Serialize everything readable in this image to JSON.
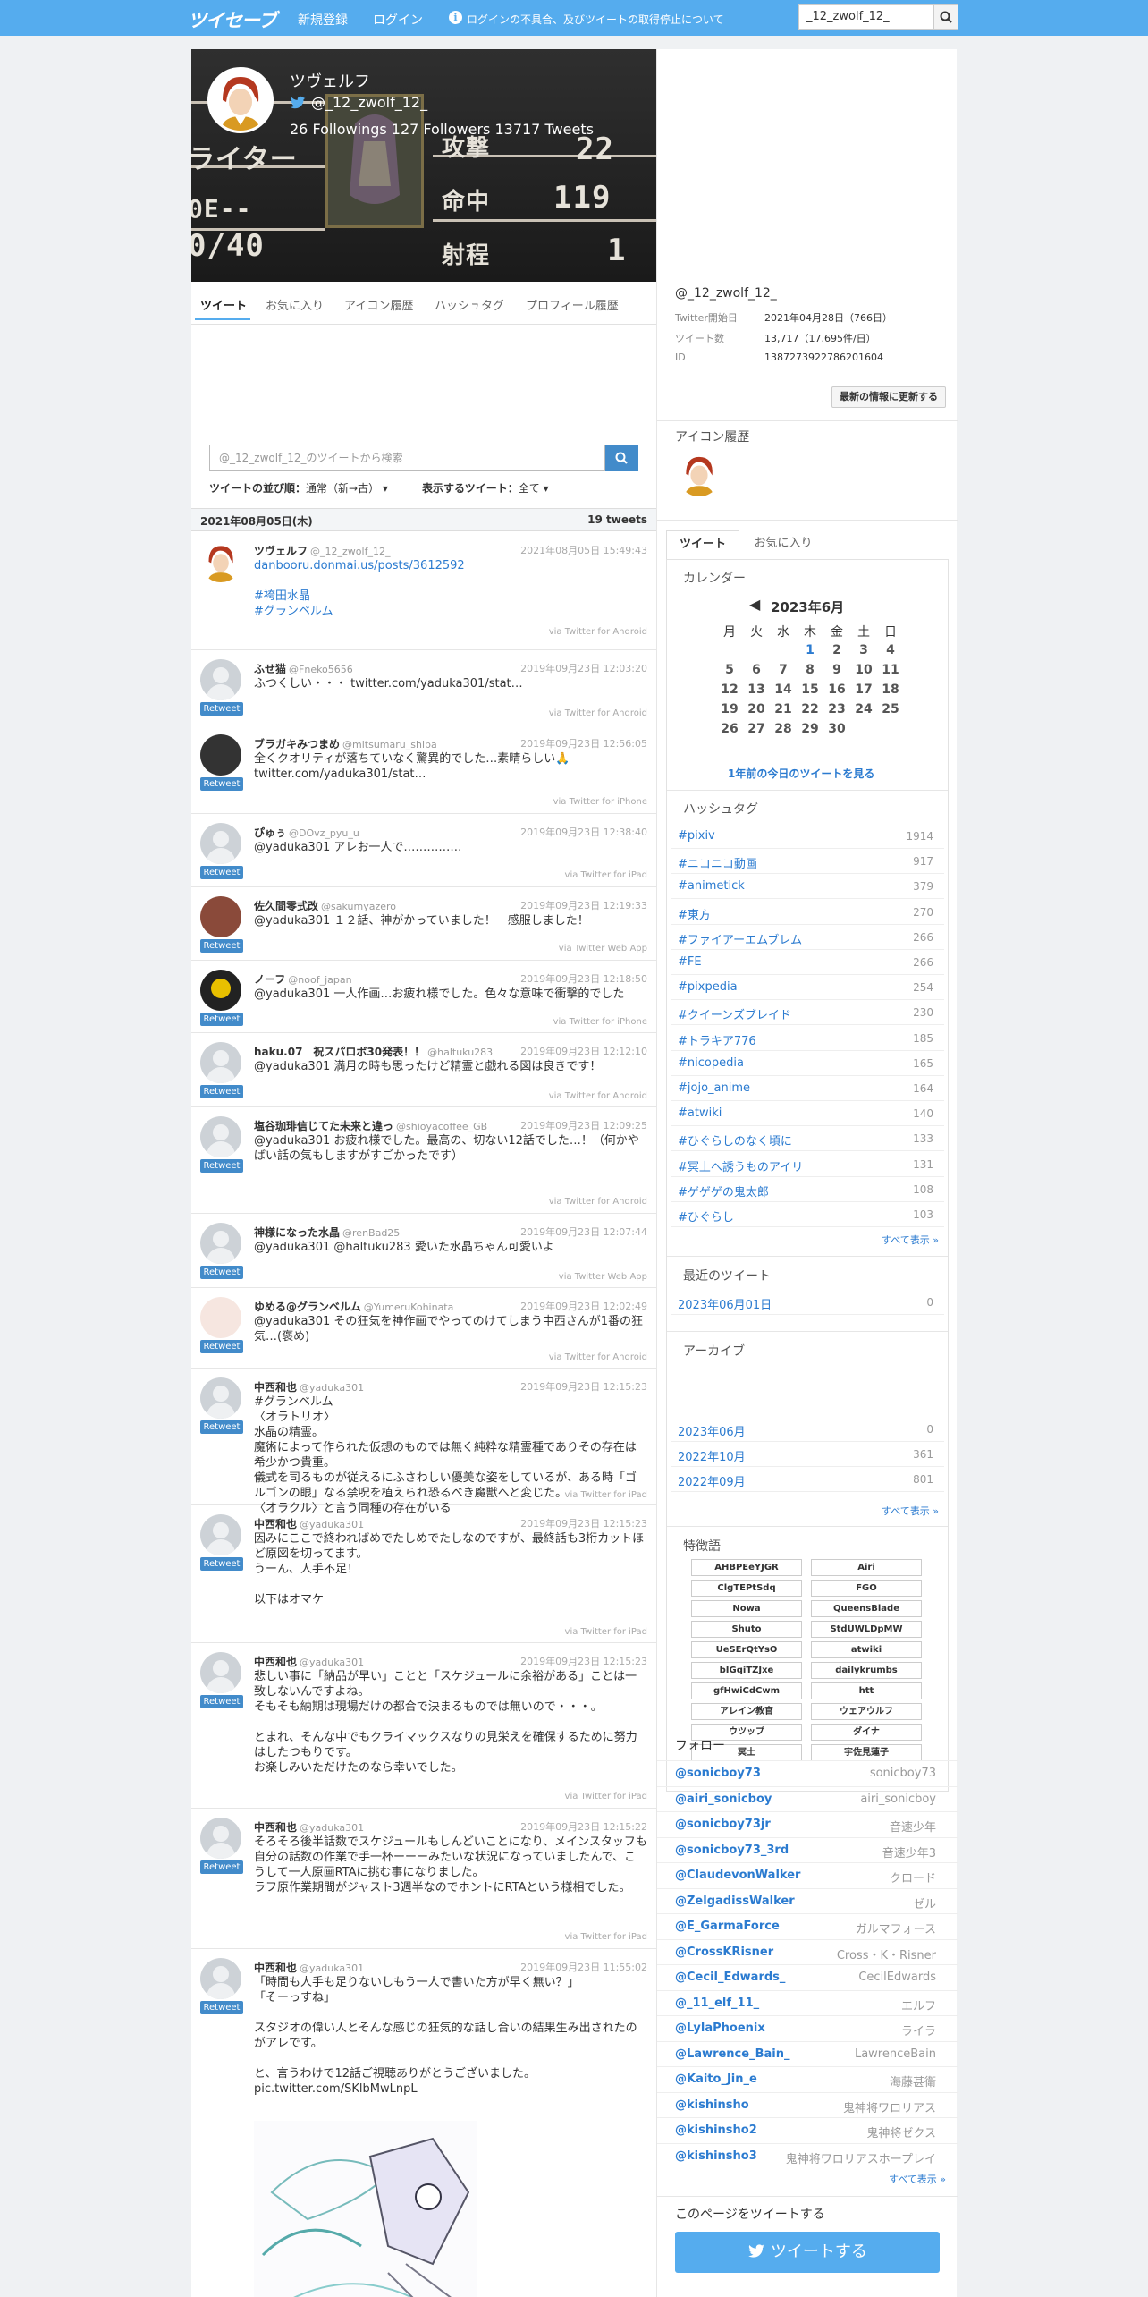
{
  "nav": {
    "logo": "ツイセーブ",
    "register": "新規登録",
    "login": "ログイン",
    "notice": "ログインの不具合、及びツイートの取得停止について",
    "search_value": "_12_zwolf_12_"
  },
  "profile": {
    "name": "ツヴェルフ",
    "handle": "@_12_zwolf_12_",
    "stats": "26 Followings 127 Followers  13717 Tweets",
    "banner_text": [
      "ライター",
      "0E--",
      "0/40",
      "攻撃",
      "22",
      "命中",
      "119",
      "射程",
      "1"
    ]
  },
  "tabs": [
    "ツイート",
    "お気に入り",
    "アイコン履歴",
    "ハッシュタグ",
    "プロフィール履歴"
  ],
  "search": {
    "placeholder": "@_12_zwolf_12_のツイートから検索"
  },
  "sort": {
    "order_label": "ツイートの並び順：",
    "order_value": "通常（新→古）",
    "show_label": "表示するツイート：",
    "show_value": "全て"
  },
  "date_header": {
    "date": "2021年08月05日(木)",
    "count": "19 tweets"
  },
  "tweets": [
    {
      "name": "ツヴェルフ",
      "handle": "@_12_zwolf_12_",
      "time": "2021年08月05日 15:49:43",
      "body": "danbooru.donmai.us/posts/3612592\n\n#袴田水晶\n#グランベルム",
      "via": "via Twitter for Android",
      "retweet": ""
    },
    {
      "name": "ふせ猫",
      "handle": "@Fneko5656",
      "time": "2019年09月23日 12:03:20",
      "body": "ふつくしい・・・ twitter.com/yaduka301/stat…",
      "via": "via Twitter for Android",
      "retweet": "Retweet"
    },
    {
      "name": "ブラガキみつまめ",
      "handle": "@mitsumaru_shiba",
      "time": "2019年09月23日 12:56:05",
      "body": "全くクオリティが落ちていなく驚異的でした…素晴らしい🙏 twitter.com/yaduka301/stat…",
      "via": "via Twitter for iPhone",
      "retweet": "Retweet"
    },
    {
      "name": "ぴゅぅ",
      "handle": "@DOvz_pyu_u",
      "time": "2019年09月23日 12:38:40",
      "body": "@yaduka301 アレお一人で……………",
      "via": "via Twitter for iPad",
      "retweet": "Retweet"
    },
    {
      "name": "佐久間零式改",
      "handle": "@sakumyazero",
      "time": "2019年09月23日 12:19:33",
      "body": "@yaduka301 １２話、神がかっていました！　感服しました！",
      "via": "via Twitter Web App",
      "retweet": "Retweet"
    },
    {
      "name": "ノーフ",
      "handle": "@noof_japan",
      "time": "2019年09月23日 12:18:50",
      "body": "@yaduka301 一人作画…お疲れ様でした。色々な意味で衝撃的でした",
      "via": "via Twitter for iPhone",
      "retweet": "Retweet"
    },
    {
      "name": "haku.07　祝スパロボ30発表！！",
      "handle": "@haltuku283",
      "time": "2019年09月23日 12:12:10",
      "body": "@yaduka301 満月の時も思ったけど精霊と戯れる図は良きです！",
      "via": "via Twitter for Android",
      "retweet": "Retweet"
    },
    {
      "name": "塩谷珈琲信じてた未来と違っ",
      "handle": "@shioyacoffee_GB",
      "time": "2019年09月23日 12:09:25",
      "body": "@yaduka301 お疲れ様でした。最高の、切ない12話でした…！（何かやばい話の気もしますがすごかったです）",
      "via": "via Twitter for Android",
      "retweet": "Retweet"
    },
    {
      "name": "神様になった水晶",
      "handle": "@renBad25",
      "time": "2019年09月23日 12:07:44",
      "body": "@yaduka301 @haltuku283 愛いた水晶ちゃん可愛いよ",
      "via": "via Twitter Web App",
      "retweet": "Retweet"
    },
    {
      "name": "ゆめる@グランベルム",
      "handle": "@YumeruKohinata",
      "time": "2019年09月23日 12:02:49",
      "body": "@yaduka301 その狂気を神作画でやってのけてしまう中西さんが1番の狂気…(褒め)",
      "via": "via Twitter for Android",
      "retweet": "Retweet"
    },
    {
      "name": "中西和也",
      "handle": "@yaduka301",
      "time": "2019年09月23日 12:15:23",
      "body": "#グランベルム\n〈オラトリオ〉\n水晶の精霊。\n魔術によって作られた仮想のものでは無く純粋な精霊種でありその存在は希少かつ貴重。\n儀式を司るものが従えるにふさわしい優美な姿をしているが、ある時「ゴルゴンの眼」なる禁呪を植えられ恐るべき魔獣へと変じた。\n〈オラクル〉と言う同種の存在がいる",
      "via": "via Twitter for iPad",
      "retweet": "Retweet"
    },
    {
      "name": "中西和也",
      "handle": "@yaduka301",
      "time": "2019年09月23日 12:15:23",
      "body": "因みにここで終わればめでたしめでたしなのですが、最終話も3桁カットほど原図を切ってます。\nうーん、人手不足！\n\n以下はオマケ",
      "via": "via Twitter for iPad",
      "retweet": "Retweet"
    },
    {
      "name": "中西和也",
      "handle": "@yaduka301",
      "time": "2019年09月23日 12:15:23",
      "body": "悲しい事に「納品が早い」ことと「スケジュールに余裕がある」ことは一致しないんですよね。\nそもそも納期は現場だけの都合で決まるものでは無いので・・・。\n\nとまれ、そんな中でもクライマックスなりの見栄えを確保するために努力はしたつもりです。\nお楽しみいただけたのなら幸いでした。",
      "via": "via Twitter for iPad",
      "retweet": "Retweet"
    },
    {
      "name": "中西和也",
      "handle": "@yaduka301",
      "time": "2019年09月23日 12:15:22",
      "body": "そろそろ後半話数でスケジュールもしんどいことになり、メインスタッフも自分の話数の作業で手一杯ーーーみたいな状況になっていましたんで、こうして一人原画RTAに挑む事になりました。\nラフ原作業期間がジャスト3週半なのでホントにRTAという様相でした。",
      "via": "via Twitter for iPad",
      "retweet": "Retweet"
    },
    {
      "name": "中西和也",
      "handle": "@yaduka301",
      "time": "2019年09月23日 11:55:02",
      "body": "「時間も人手も足りないしもう一人で書いた方が早く無い？」\n「そーっすね」\n\nスタジオの偉い人とそんな感じの狂気的な話し合いの結果生み出されたのがアレです。\n\nと、言うわけで12話ご視聴ありがとうございました。 pic.twitter.com/SKlbMwLnpL",
      "via": "",
      "retweet": "Retweet"
    }
  ],
  "sidebar": {
    "handle": "@_12_zwolf_12_",
    "info": [
      {
        "k": "Twitter開始日",
        "v": "2021年04月28日（766日）"
      },
      {
        "k": "ツイート数",
        "v": "13,717（17.695件/日）"
      },
      {
        "k": "ID",
        "v": "1387273922786201604"
      }
    ],
    "update_button": "最新の情報に更新する",
    "icon_history_title": "アイコン履歴",
    "tabs": [
      "ツイート",
      "お気に入り"
    ],
    "calendar": {
      "title": "カレンダー",
      "month": "2023年6月",
      "weekdays": [
        "月",
        "火",
        "水",
        "木",
        "金",
        "土",
        "日"
      ],
      "weeks": [
        [
          "",
          "",
          "",
          "1",
          "2",
          "3",
          "4"
        ],
        [
          "5",
          "6",
          "7",
          "8",
          "9",
          "10",
          "11"
        ],
        [
          "12",
          "13",
          "14",
          "15",
          "16",
          "17",
          "18"
        ],
        [
          "19",
          "20",
          "21",
          "22",
          "23",
          "24",
          "25"
        ],
        [
          "26",
          "27",
          "28",
          "29",
          "30",
          "",
          ""
        ]
      ],
      "link": "1年前の今日のツイートを見る",
      "highlight": "1"
    },
    "hashtags_title": "ハッシュタグ",
    "hashtags": [
      {
        "k": "#pixiv",
        "v": "1914"
      },
      {
        "k": "#ニコニコ動画",
        "v": "917"
      },
      {
        "k": "#animetick",
        "v": "379"
      },
      {
        "k": "#東方",
        "v": "270"
      },
      {
        "k": "#ファイアーエムブレム",
        "v": "266"
      },
      {
        "k": "#FE",
        "v": "266"
      },
      {
        "k": "#pixpedia",
        "v": "254"
      },
      {
        "k": "#クイーンズブレイド",
        "v": "230"
      },
      {
        "k": "#トラキア776",
        "v": "185"
      },
      {
        "k": "#nicopedia",
        "v": "165"
      },
      {
        "k": "#jojo_anime",
        "v": "164"
      },
      {
        "k": "#atwiki",
        "v": "140"
      },
      {
        "k": "#ひぐらしのなく頃に",
        "v": "133"
      },
      {
        "k": "#冥土へ誘うものアイリ",
        "v": "131"
      },
      {
        "k": "#ゲゲゲの鬼太郎",
        "v": "108"
      },
      {
        "k": "#ひぐらし",
        "v": "103"
      }
    ],
    "see_all": "すべて表示 »",
    "recent_title": "最近のツイート",
    "recent": [
      {
        "k": "2023年06月01日",
        "v": "0"
      }
    ],
    "archive_title": "アーカイブ",
    "archive": [
      {
        "k": "2023年06月",
        "v": "0"
      },
      {
        "k": "2022年10月",
        "v": "361"
      },
      {
        "k": "2022年09月",
        "v": "801"
      }
    ],
    "features_title": "特徴語",
    "features": [
      "AHBPEeYJGR",
      "Airi",
      "ClgTEPtSdq",
      "FGO",
      "Nowa",
      "QueensBlade",
      "Shuto",
      "StdUWLDpMW",
      "UeSErQtYsO",
      "atwiki",
      "bIGqiTZJxe",
      "dailykrumbs",
      "gfHwiCdCwm",
      "htt",
      "アレイン教官",
      "ウェアウルフ",
      "ウツップ",
      "ダイナ",
      "冥土",
      "宇佐見蓮子"
    ],
    "follow_title": "フォロー",
    "follows": [
      {
        "k": "@sonicboy73",
        "v": "sonicboy73"
      },
      {
        "k": "@airi_sonicboy",
        "v": "airi_sonicboy"
      },
      {
        "k": "@sonicboy73jr",
        "v": "音速少年"
      },
      {
        "k": "@sonicboy73_3rd",
        "v": "音速少年3"
      },
      {
        "k": "@ClaudevonWalker",
        "v": "クロード"
      },
      {
        "k": "@ZelgadissWalker",
        "v": "ゼル"
      },
      {
        "k": "@E_GarmaForce",
        "v": "ガルマフォース"
      },
      {
        "k": "@CrossKRisner",
        "v": "Cross・K・Risner"
      },
      {
        "k": "@Cecil_Edwards_",
        "v": "CecilEdwards"
      },
      {
        "k": "@_11_elf_11_",
        "v": "エルフ"
      },
      {
        "k": "@LylaPhoenix",
        "v": "ライラ"
      },
      {
        "k": "@Lawrence_Bain_",
        "v": "LawrenceBain"
      },
      {
        "k": "@Kaito_Jin_e",
        "v": "海藤甚衛"
      },
      {
        "k": "@kishinsho",
        "v": "鬼神将ワロリアス"
      },
      {
        "k": "@kishinsho2",
        "v": "鬼神将ゼクス"
      },
      {
        "k": "@kishinsho3",
        "v": "鬼神将ワロリアスホープレイ"
      }
    ],
    "tweet_page_title": "このページをツイートする",
    "tweet_button": "ツイートする"
  }
}
